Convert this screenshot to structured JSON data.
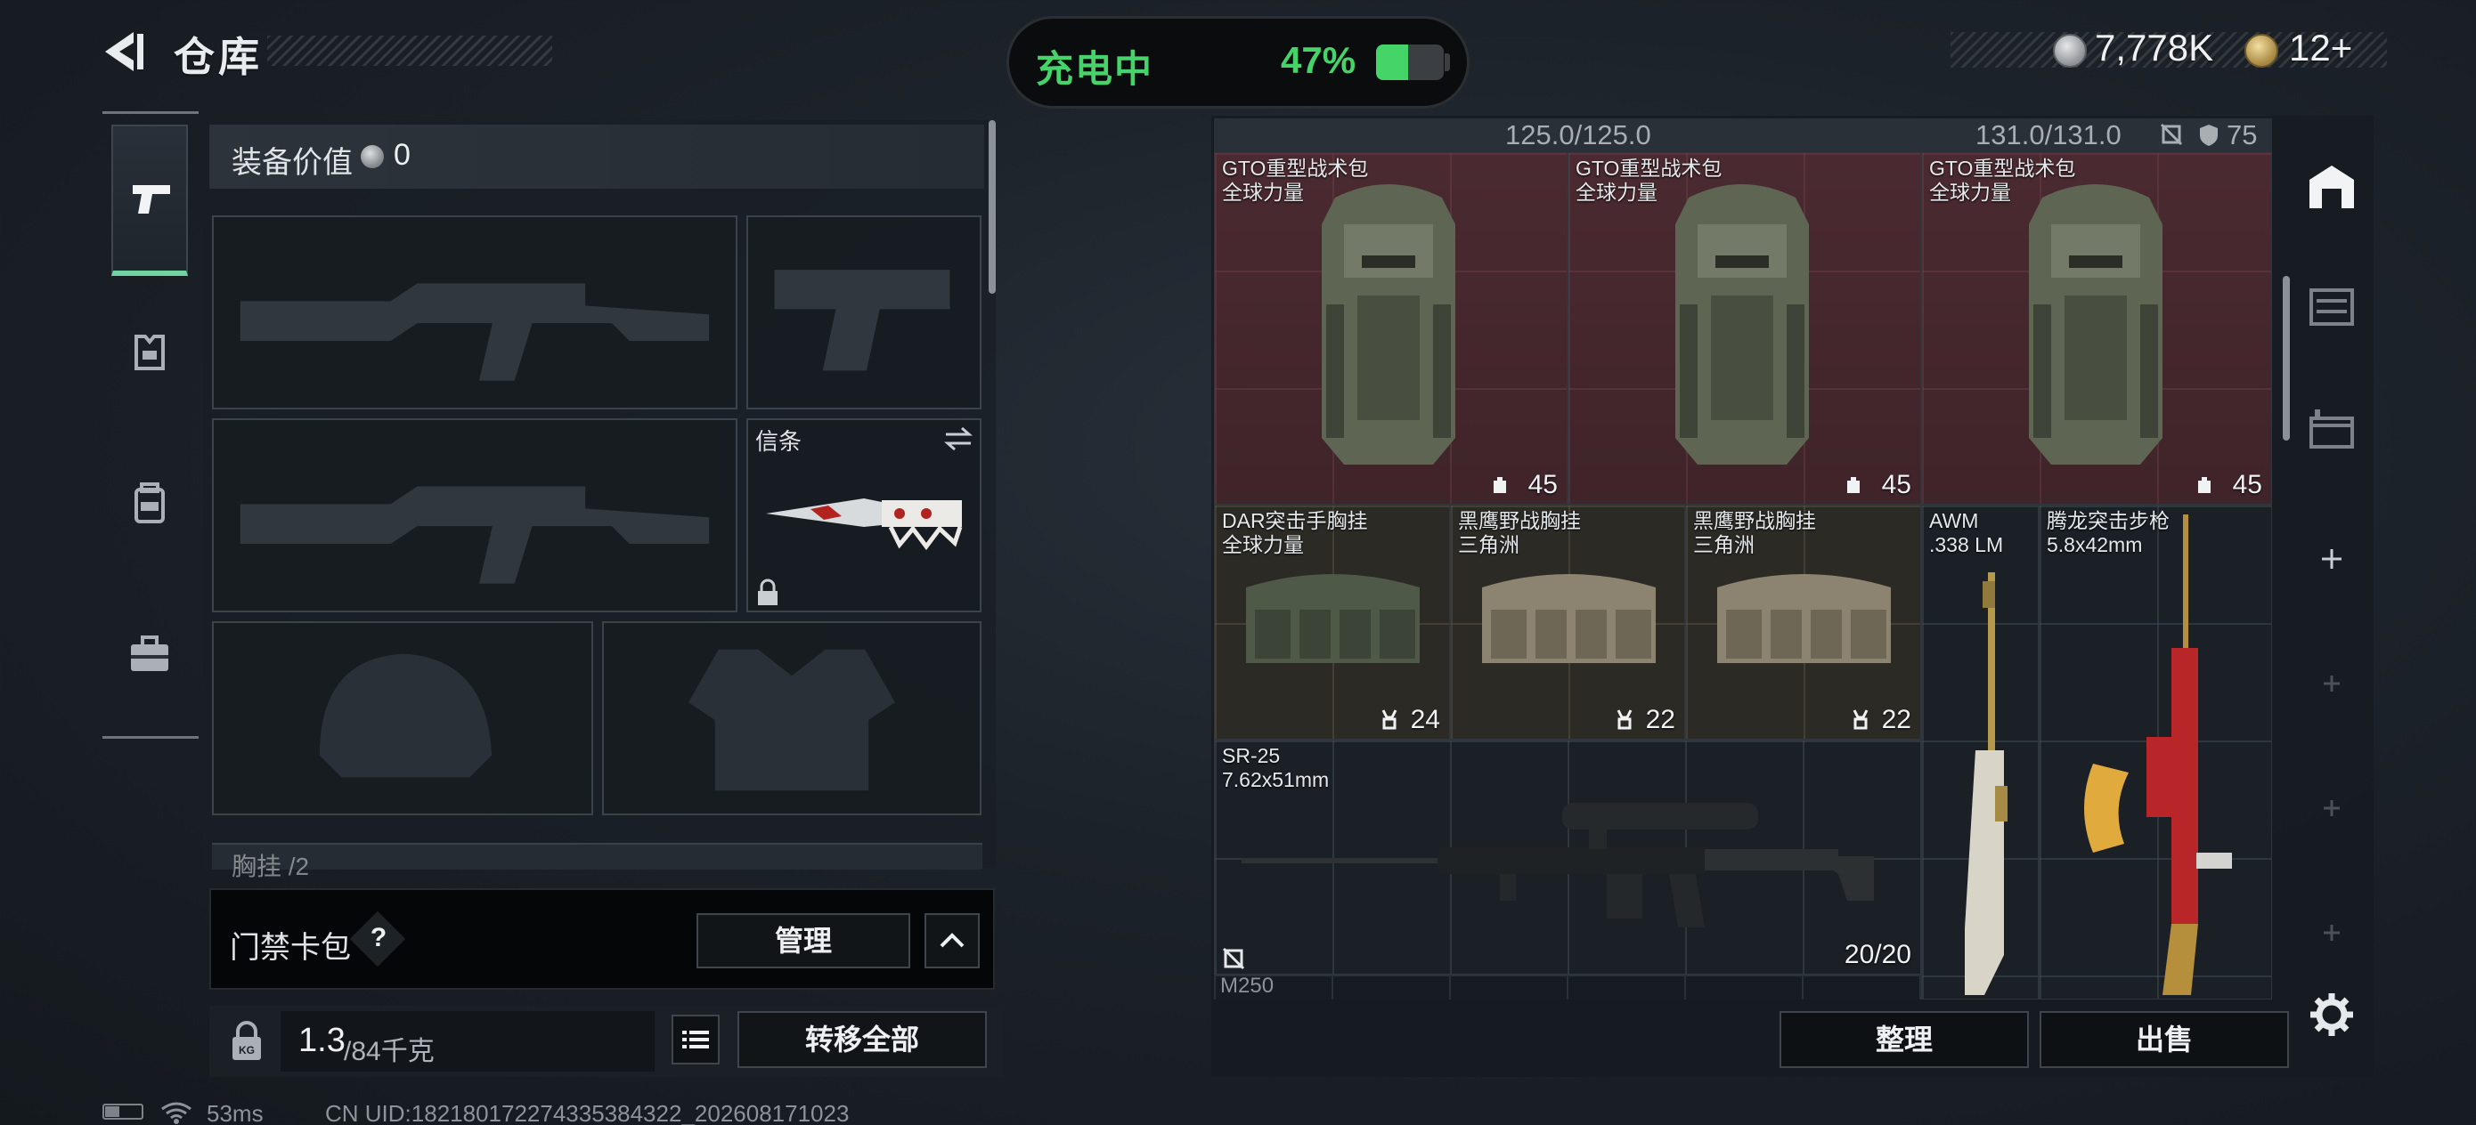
{
  "header": {
    "title": "仓库",
    "charging_label": "充电中",
    "battery_percent_text": "47%",
    "battery_level": 0.47,
    "silver_amount": "7,778K",
    "gold_amount": "12+"
  },
  "tabs": [
    {
      "icon": "pistol-icon",
      "active": true
    },
    {
      "icon": "armor-vest-icon",
      "active": false
    },
    {
      "icon": "backpack-icon",
      "active": false
    },
    {
      "icon": "briefcase-icon",
      "active": false
    }
  ],
  "equipment": {
    "value_label": "装备价值",
    "value_amount": "0",
    "melee_label": "信条",
    "next_section_label": "胸挂 /2"
  },
  "keycard": {
    "label": "门禁卡包",
    "help": "?",
    "manage_label": "管理"
  },
  "weight": {
    "current": "1.3",
    "max": "/84千克",
    "transfer_label": "转移全部"
  },
  "status": {
    "ping": "53ms",
    "uid": "CN UID:18218017227433538432​2_202608171023"
  },
  "stash": {
    "capacity_1": "125.0/125.0",
    "capacity_2": "131.0/131.0",
    "armor_value": "75",
    "items": [
      {
        "name": "GTO重型战术包",
        "sub": "全球力量",
        "cap": "45"
      },
      {
        "name": "GTO重型战术包",
        "sub": "全球力量",
        "cap": "45"
      },
      {
        "name": "GTO重型战术包",
        "sub": "全球力量",
        "cap": "45"
      },
      {
        "name": "DAR突击手胸挂",
        "sub": "全球力量",
        "cap": "24"
      },
      {
        "name": "黑鹰野战胸挂",
        "sub": "三角洲",
        "cap": "22"
      },
      {
        "name": "黑鹰野战胸挂",
        "sub": "三角洲",
        "cap": "22"
      },
      {
        "name": "AWM",
        "sub": ".338 LM"
      },
      {
        "name": "腾龙突击步枪",
        "sub": "5.8x42mm"
      },
      {
        "name": "SR-25",
        "sub": "7.62x51mm",
        "ammo": "20/20"
      }
    ],
    "bottom_row_label": "M250",
    "organize_label": "整理",
    "sell_label": "出售"
  },
  "colors": {
    "charging_green": "#46d36a",
    "active_tab_accent": "#6fd3a3",
    "backpack_tile": "#4a2a30",
    "rig_tile": "#2c2a25"
  }
}
